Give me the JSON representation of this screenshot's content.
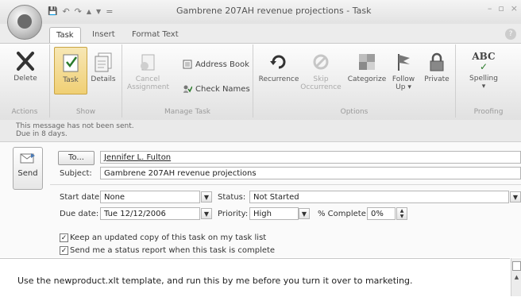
{
  "window": {
    "title": "Gambrene 207AH revenue projections - Task",
    "controls": [
      "–",
      "▫",
      "×"
    ]
  },
  "quick_access": [
    "💾",
    "↶",
    "↷",
    "▲",
    "▼",
    "="
  ],
  "tabs": [
    {
      "label": "Task"
    },
    {
      "label": "Insert"
    },
    {
      "label": "Format Text"
    }
  ],
  "ribbon": {
    "groups": {
      "actions": "Actions",
      "show": "Show",
      "manage_task": "Manage Task",
      "options": "Options",
      "proofing": "Proofing"
    },
    "buttons": {
      "delete": "Delete",
      "task": "Task",
      "details": "Details",
      "cancel_assignment_1": "Cancel",
      "cancel_assignment_2": "Assignment",
      "address_book": "Address Book",
      "check_names": "Check Names",
      "recurrence": "Recurrence",
      "skip_occurrence_1": "Skip",
      "skip_occurrence_2": "Occurrence",
      "categorize": "Categorize",
      "follow_up_1": "Follow",
      "follow_up_2": "Up",
      "private": "Private",
      "spelling": "Spelling",
      "spelling_icon_text": "ABC"
    }
  },
  "infobar": {
    "line1": "This message has not been sent.",
    "line2": "Due in 8 days."
  },
  "form": {
    "send_label": "Send",
    "to_button": "To...",
    "to_value": "Jennifer L. Fulton",
    "subject_label": "Subject:",
    "subject_value": "Gambrene 207AH revenue projections",
    "start_date_label": "Start date:",
    "start_date_value": "None",
    "due_date_label": "Due date:",
    "due_date_value": "Tue 12/12/2006",
    "status_label": "Status:",
    "status_value": "Not Started",
    "priority_label": "Priority:",
    "priority_value": "High",
    "percent_label": "% Complete:",
    "percent_value": "0%",
    "keep_copy_label": "Keep an updated copy of this task on my task list",
    "status_report_label": "Send me a status report when this task is complete",
    "keep_copy_checked": true,
    "status_report_checked": true
  },
  "body": {
    "text": "Use the newproduct.xlt template, and run this by me before you turn it over to marketing."
  }
}
